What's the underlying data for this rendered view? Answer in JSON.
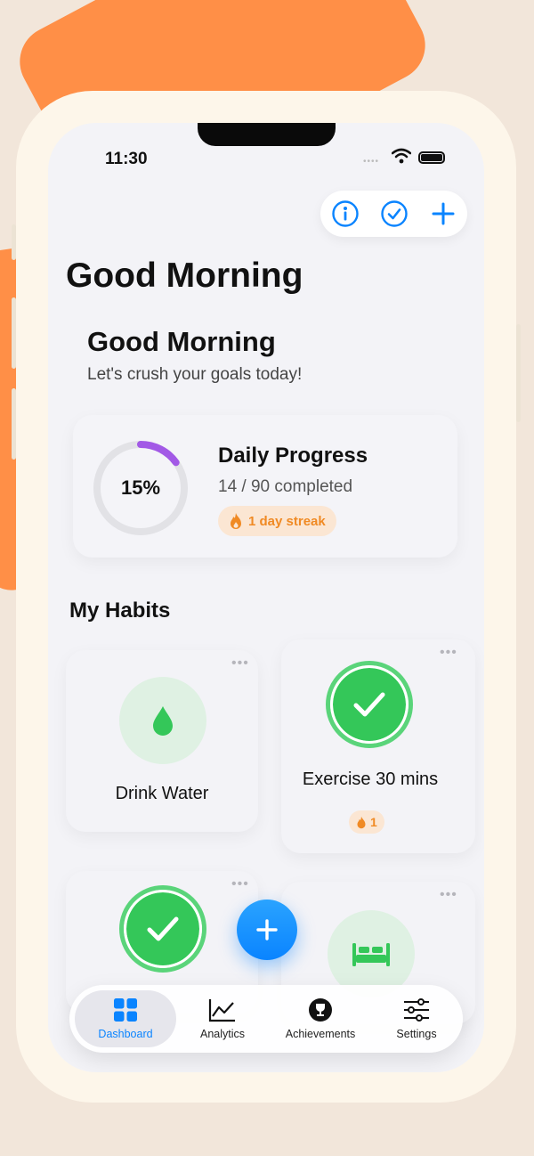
{
  "status_bar": {
    "time": "11:30"
  },
  "toolbar": {
    "info_icon": "info-icon",
    "check_icon": "checkmark-circle-icon",
    "add_icon": "plus-icon"
  },
  "header": {
    "large_title": "Good Morning"
  },
  "greeting": {
    "title": "Good Morning",
    "subtitle": "Let's crush your goals today!"
  },
  "progress": {
    "percent_label": "15%",
    "percent": 0.15,
    "title": "Daily Progress",
    "completed_text": "14 / 90 completed",
    "streak_text": "1 day streak"
  },
  "habits_section": {
    "title": "My Habits"
  },
  "habits": [
    {
      "name": "Drink Water",
      "icon": "water-drop-icon",
      "done": false
    },
    {
      "name": "Exercise 30 mins",
      "icon": "checkmark-icon",
      "done": true,
      "streak": "1"
    },
    {
      "name": "",
      "icon": "checkmark-icon",
      "done": true
    },
    {
      "name": "",
      "icon": "bed-icon",
      "done": false
    }
  ],
  "tabs": [
    {
      "label": "Dashboard",
      "icon": "grid-icon",
      "active": true
    },
    {
      "label": "Analytics",
      "icon": "line-chart-icon",
      "active": false
    },
    {
      "label": "Achievements",
      "icon": "trophy-icon",
      "active": false
    },
    {
      "label": "Settings",
      "icon": "sliders-icon",
      "active": false
    }
  ],
  "colors": {
    "accent_blue": "#0a84ff",
    "success_green": "#34c759",
    "streak_orange": "#f08a24",
    "progress_purple": "#a259e6",
    "background_orange": "#ff8f47"
  }
}
